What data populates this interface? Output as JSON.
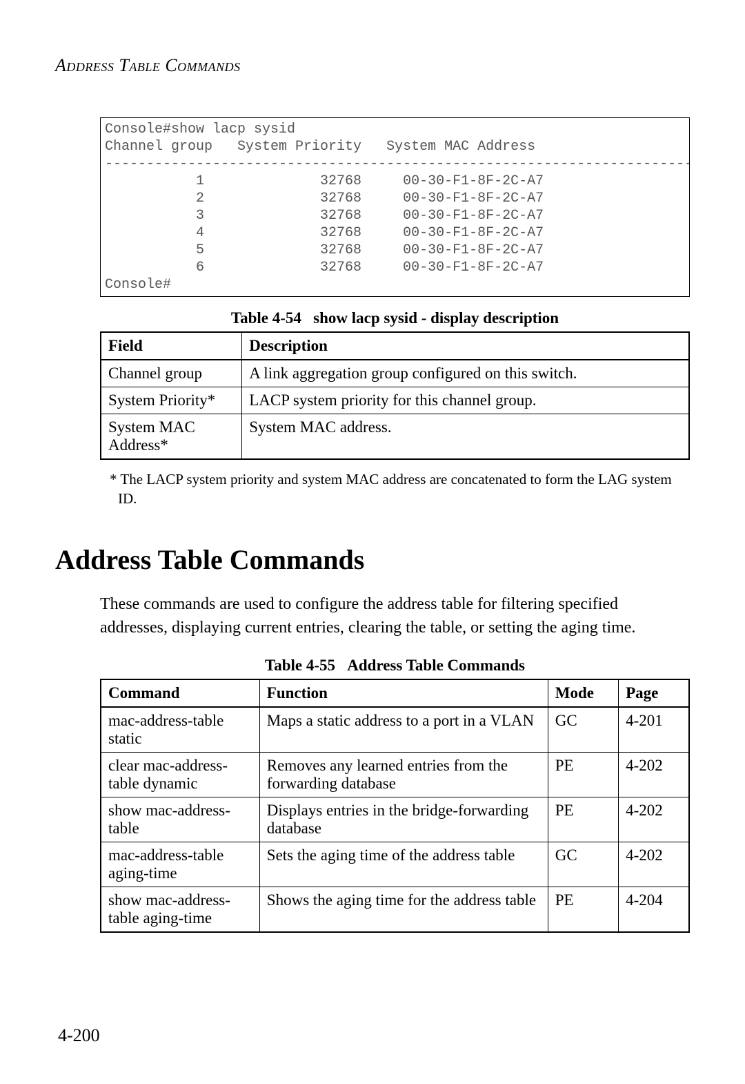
{
  "running_head": "Address Table Commands",
  "console_output": "Console#show lacp sysid\nChannel group   System Priority   System MAC Address\n-------------------------------------------------------------------------\n           1              32768     00-30-F1-8F-2C-A7\n           2              32768     00-30-F1-8F-2C-A7\n           3              32768     00-30-F1-8F-2C-A7\n           4              32768     00-30-F1-8F-2C-A7\n           5              32768     00-30-F1-8F-2C-A7\n           6              32768     00-30-F1-8F-2C-A7\nConsole#",
  "table54": {
    "caption_label": "Table 4-54",
    "caption_title": "show lacp sysid - display description",
    "headers": {
      "field": "Field",
      "description": "Description"
    },
    "rows": [
      {
        "field": "Channel group",
        "description": "A link aggregation group configured on this switch."
      },
      {
        "field": "System Priority*",
        "description": "LACP system priority for this channel group."
      },
      {
        "field": "System MAC Address*",
        "description": "System MAC address."
      }
    ]
  },
  "footnote": "* The LACP system priority and system MAC address are concatenated to form the LAG system ID.",
  "section_heading": "Address Table Commands",
  "body_para": "These commands are used to configure the address table for filtering specified addresses, displaying current entries, clearing the table, or setting the aging time.",
  "table55": {
    "caption_label": "Table 4-55",
    "caption_title": "Address Table Commands",
    "headers": {
      "command": "Command",
      "function": "Function",
      "mode": "Mode",
      "page": "Page"
    },
    "rows": [
      {
        "command": "mac-address-table static",
        "function": "Maps a static address to a port in a VLAN",
        "mode": "GC",
        "page": "4-201"
      },
      {
        "command": "clear mac-address-table dynamic",
        "function": "Removes any learned entries from the forwarding database",
        "mode": "PE",
        "page": "4-202"
      },
      {
        "command": "show mac-address-table",
        "function": "Displays entries in the bridge-forwarding database",
        "mode": "PE",
        "page": "4-202"
      },
      {
        "command": "mac-address-table aging-time",
        "function": "Sets the aging time of the address table",
        "mode": "GC",
        "page": "4-202"
      },
      {
        "command": "show mac-address-table aging-time",
        "function": "Shows the aging time for the address table",
        "mode": "PE",
        "page": "4-204"
      }
    ]
  },
  "page_number": "4-200"
}
